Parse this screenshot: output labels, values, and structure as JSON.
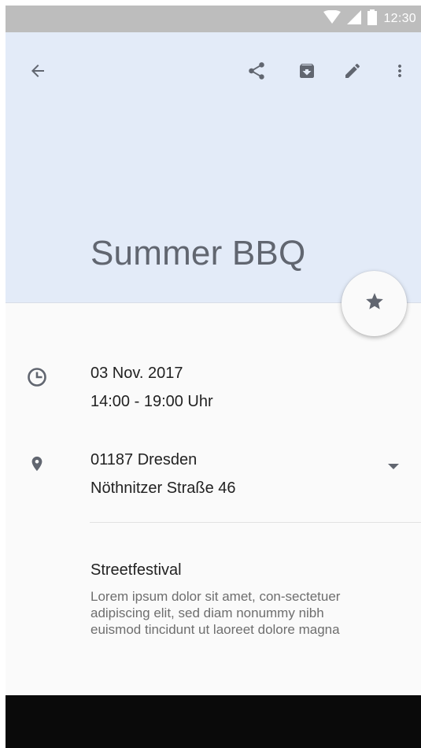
{
  "status_bar": {
    "time": "12:30"
  },
  "toolbar": {
    "back_icon": "arrow-back-icon",
    "share_icon": "share-icon",
    "archive_icon": "archive-icon",
    "edit_icon": "edit-pencil-icon",
    "more_icon": "more-vert-icon"
  },
  "event": {
    "title": "Summer BBQ",
    "date": "03 Nov. 2017",
    "time_range": "14:00  - 19:00 Uhr",
    "location_city": "01187 Dresden",
    "location_street": "Nöthnitzer Straße 46",
    "description_title": "Streetfestival",
    "description_body": "Lorem ipsum dolor sit amet, con-sectetuer adipiscing elit, sed diam nonummy nibh euismod tincidunt ut laoreet dolore magna"
  },
  "fab": {
    "icon": "star-icon"
  },
  "colors": {
    "header_bg": "#e3ebf8",
    "status_bar": "#bdbdbd",
    "icon_gray": "#616670",
    "body_bg": "#fafafa"
  }
}
